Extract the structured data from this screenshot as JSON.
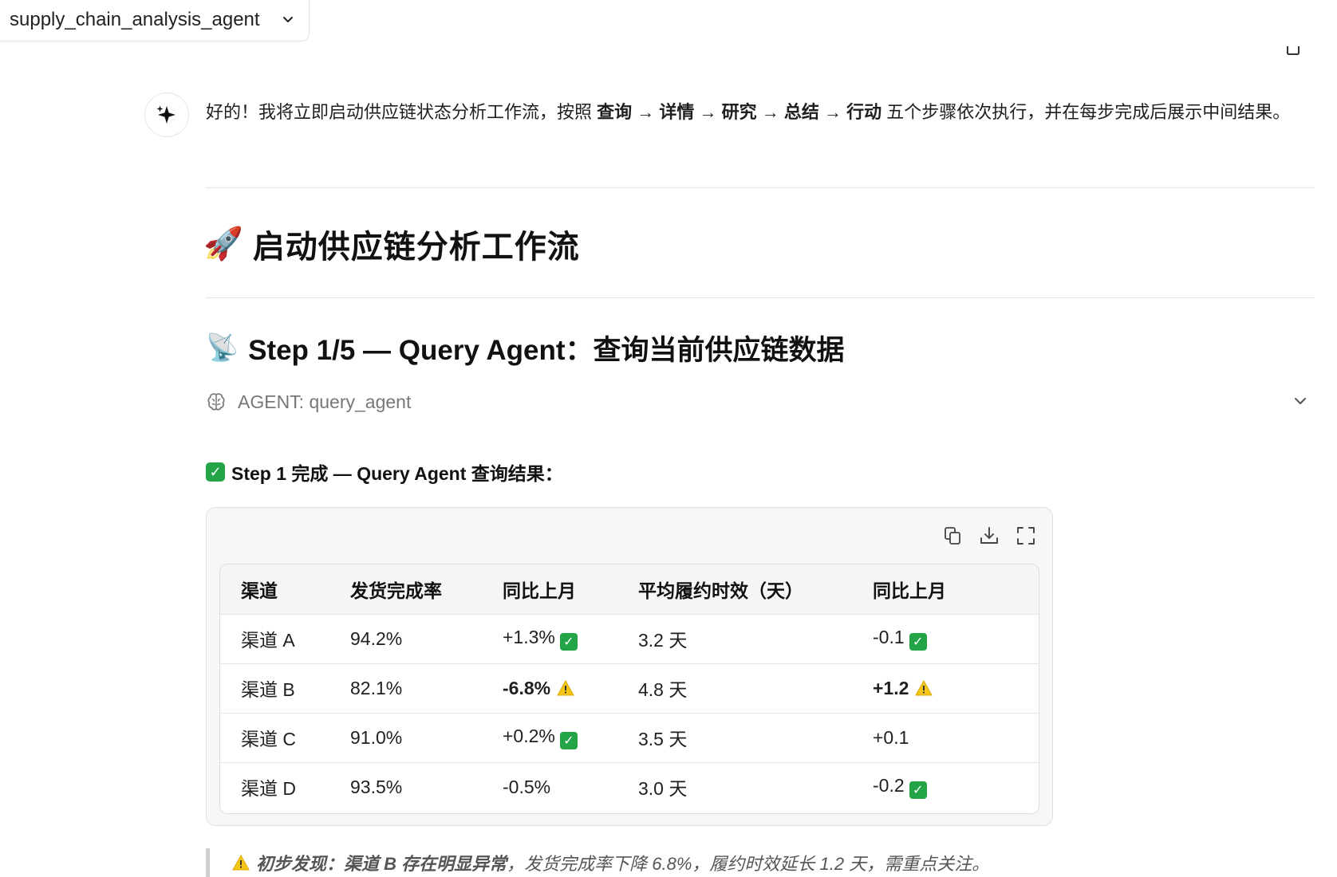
{
  "agent_selector": {
    "name": "supply_chain_analysis_agent"
  },
  "message": {
    "intro_prefix": "好的！我将立即启动供应链状态分析工作流，按照 ",
    "intro_steps": [
      {
        "label": "查询",
        "sep": " → "
      },
      {
        "label": "详情",
        "sep": " → "
      },
      {
        "label": "研究",
        "sep": " → "
      },
      {
        "label": "总结",
        "sep": " → "
      },
      {
        "label": "行动",
        "sep": ""
      }
    ],
    "intro_suffix": " 五个步骤依次执行，并在每步完成后展示中间结果。",
    "main_heading_emoji": "🚀",
    "main_heading": "启动供应链分析工作流",
    "step_heading_emoji": "📡",
    "step_heading": "Step 1/5 — Query Agent：查询当前供应链数据",
    "agent_line": "AGENT: query_agent",
    "done_line": "Step 1 完成 — Query Agent 查询结果："
  },
  "table": {
    "headers": [
      "渠道",
      "发货完成率",
      "同比上月",
      "平均履约时效（天）",
      "同比上月"
    ],
    "rows": [
      {
        "channel": "渠道 A",
        "rate": "94.2%",
        "rate_change": "+1.3%",
        "rate_flag": "ok",
        "rate_bold": false,
        "days": "3.2 天",
        "days_change": "-0.1",
        "days_flag": "ok",
        "days_bold": false
      },
      {
        "channel": "渠道 B",
        "rate": "82.1%",
        "rate_change": "-6.8%",
        "rate_flag": "warn",
        "rate_bold": true,
        "days": "4.8 天",
        "days_change": "+1.2",
        "days_flag": "warn",
        "days_bold": true
      },
      {
        "channel": "渠道 C",
        "rate": "91.0%",
        "rate_change": "+0.2%",
        "rate_flag": "ok",
        "rate_bold": false,
        "days": "3.5 天",
        "days_change": "+0.1",
        "days_flag": "",
        "days_bold": false
      },
      {
        "channel": "渠道 D",
        "rate": "93.5%",
        "rate_change": "-0.5%",
        "rate_flag": "",
        "rate_bold": false,
        "days": "3.0 天",
        "days_change": "-0.2",
        "days_flag": "ok",
        "days_bold": false
      }
    ]
  },
  "finding": {
    "lead": "初步发现：渠道 B 存在明显异常",
    "rest": "，发货完成率下降 6.8%，履约时效延长 1.2 天，需重点关注。"
  },
  "colors": {
    "check_green": "#22a447",
    "warn_yellow": "#f5c518"
  }
}
